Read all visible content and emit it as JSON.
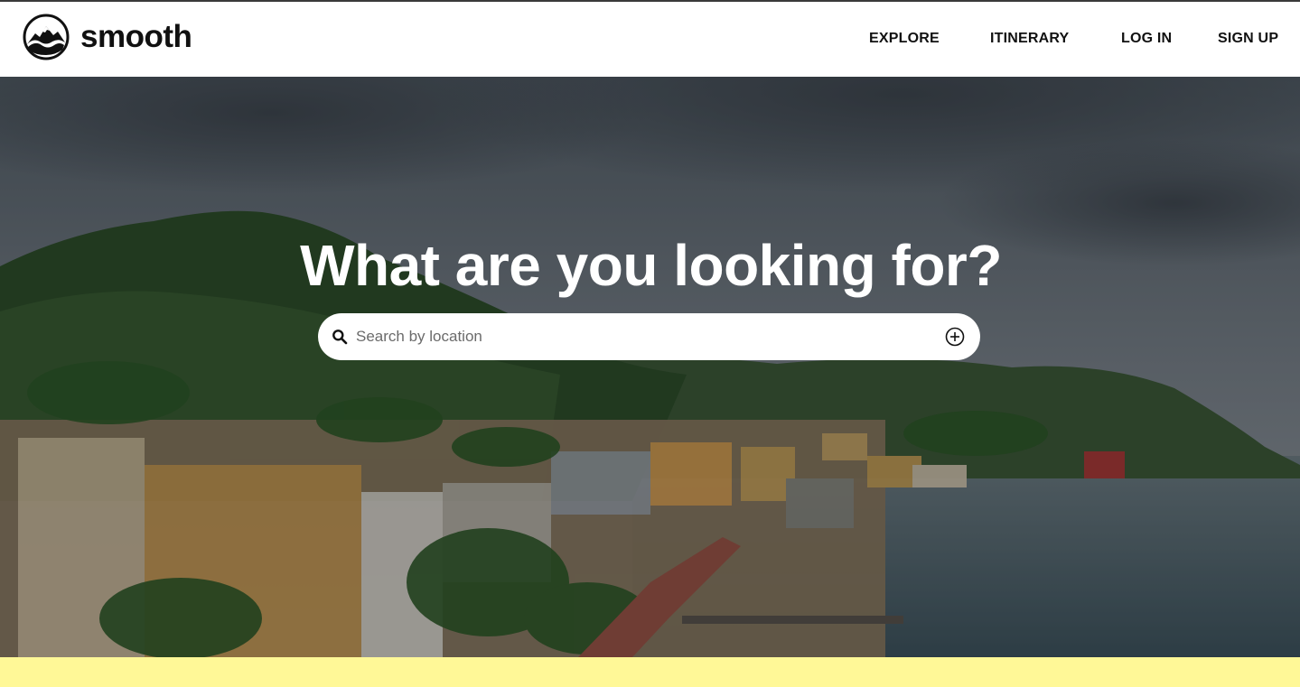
{
  "brand": {
    "name": "smooth",
    "logo": "mountain-logo-icon"
  },
  "nav": {
    "items": [
      {
        "label": "EXPLORE"
      },
      {
        "label": "ITINERARY"
      },
      {
        "label": "LOG IN"
      },
      {
        "label": "SIGN UP"
      }
    ]
  },
  "hero": {
    "headline": "What are you looking for?",
    "search": {
      "placeholder": "Search by location",
      "value": "",
      "icon": "search-icon",
      "action_icon": "add-circle-icon"
    }
  },
  "colors": {
    "accent_band": "#fff897",
    "header_bg": "#ffffff",
    "text": "#111111"
  }
}
